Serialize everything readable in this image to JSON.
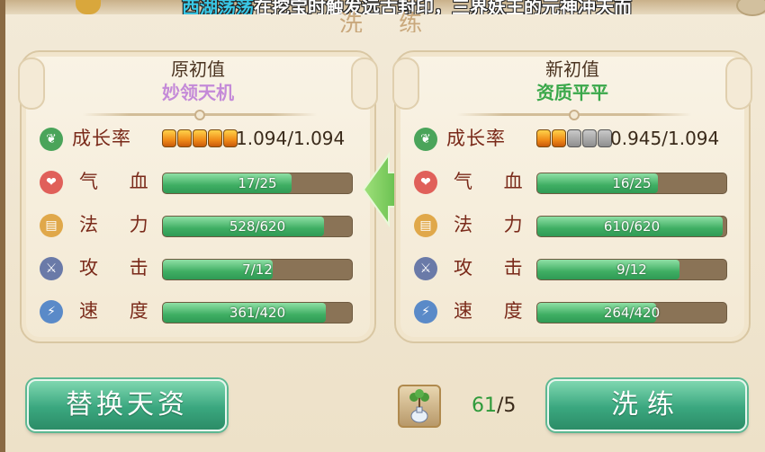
{
  "marquee": {
    "name": "西湖荡荡",
    "message": "在挖宝时触发远古封印，三界妖王的元神冲天而"
  },
  "dialog": {
    "title": "洗 练"
  },
  "left_panel": {
    "heading": "原初值",
    "subtitle": "妙领天机",
    "growth": {
      "label": "成长率",
      "gems_filled": 5,
      "gems_total": 5,
      "value": "1.094/1.094"
    },
    "stats": [
      {
        "key": "hp",
        "label": "气 血",
        "value": "17/25",
        "fill": 0.68
      },
      {
        "key": "mp",
        "label": "法 力",
        "value": "528/620",
        "fill": 0.85
      },
      {
        "key": "atk",
        "label": "攻 击",
        "value": "7/12",
        "fill": 0.58
      },
      {
        "key": "spd",
        "label": "速 度",
        "value": "361/420",
        "fill": 0.86
      }
    ]
  },
  "right_panel": {
    "heading": "新初值",
    "subtitle": "资质平平",
    "growth": {
      "label": "成长率",
      "gems_filled": 2,
      "gems_total": 5,
      "value": "0.945/1.094"
    },
    "stats": [
      {
        "key": "hp",
        "label": "气 血",
        "value": "16/25",
        "fill": 0.64
      },
      {
        "key": "mp",
        "label": "法 力",
        "value": "610/620",
        "fill": 0.98
      },
      {
        "key": "atk",
        "label": "攻 击",
        "value": "9/12",
        "fill": 0.75
      },
      {
        "key": "spd",
        "label": "速 度",
        "value": "264/420",
        "fill": 0.63
      }
    ]
  },
  "bottom": {
    "replace_button": "替换天资",
    "wash_button": "洗练",
    "item_have": "61",
    "item_need": "/5",
    "item_icon": "tree-vase-icon"
  },
  "colors": {
    "bar_fill": "#3fae63",
    "bar_track": "#8a7356",
    "gem_on": "#f08a18",
    "gem_off": "#8e8e8e",
    "button": "#3aa77f"
  }
}
